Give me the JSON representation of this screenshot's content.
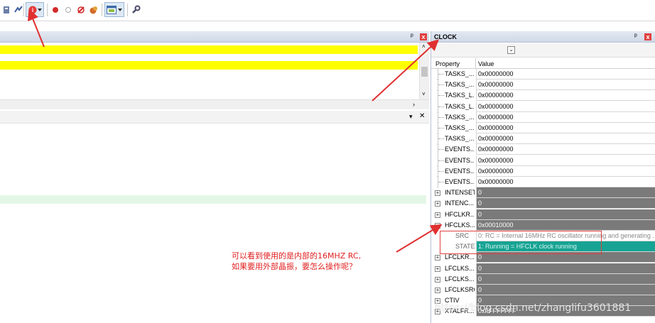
{
  "toolbar": {
    "icons": [
      "step-icon",
      "reset-icon",
      "trace-icon",
      "breakpoint-icon",
      "breakpoint-empty-icon",
      "disable-breakpoint-icon",
      "kill-breakpoints-icon",
      "window-layout-icon",
      "settings-wrench-icon"
    ]
  },
  "clock_pane": {
    "title": "CLOCK",
    "pin_glyph": "ᵖ",
    "close_glyph": "x",
    "columns": {
      "property": "Property",
      "value": "Value"
    },
    "rows": [
      {
        "name": "TASKS_...",
        "value": "0x00000000"
      },
      {
        "name": "TASKS_...",
        "value": "0x00000000"
      },
      {
        "name": "TASKS_L...",
        "value": "0x00000000"
      },
      {
        "name": "TASKS_L...",
        "value": "0x00000000"
      },
      {
        "name": "TASKS_...",
        "value": "0x00000000"
      },
      {
        "name": "TASKS_...",
        "value": "0x00000000"
      },
      {
        "name": "TASKS_...",
        "value": "0x00000000"
      },
      {
        "name": "EVENTS...",
        "value": "0x00000000"
      },
      {
        "name": "EVENTS...",
        "value": "0x00000000"
      },
      {
        "name": "EVENTS...",
        "value": "0x00000000"
      },
      {
        "name": "EVENTS...",
        "value": "0x00000000"
      },
      {
        "name": "INTENSET",
        "value": "0"
      },
      {
        "name": "INTENC...",
        "value": "0"
      },
      {
        "name": "HFCLKR...",
        "value": "0"
      },
      {
        "name": "HFCLKS...",
        "value": "0x00010000"
      },
      {
        "name": "SRC",
        "value": "0: RC = Internal 16MHz RC oscillator running and generating ..."
      },
      {
        "name": "STATE",
        "value": "1: Running = HFCLK clock running"
      },
      {
        "name": "LFCLKR...",
        "value": "0"
      },
      {
        "name": "LFCLKS...",
        "value": "0"
      },
      {
        "name": "LFCLKS...",
        "value": "0"
      },
      {
        "name": "LFCLKSRC",
        "value": "0"
      },
      {
        "name": "CTIV",
        "value": "0"
      },
      {
        "name": "XTALFR...",
        "value": "0xFFFFFFFF"
      }
    ]
  },
  "left_pane": {
    "close_glyph": "✕",
    "pin_glyph": "ᵖ",
    "dropdown_glyph": "▾"
  },
  "annotation": {
    "line1": "可以看到使用的是内部的16MHZ RC,",
    "line2": "如果要用外部晶振，要怎么操作呢？"
  },
  "watermark": "https://blog.csdn.net/zhanglifu3601881",
  "colors": {
    "highlight": "#ffff00",
    "gray_value": "#7a7a7a",
    "teal_value": "#17a393",
    "annotation": "#e02020"
  }
}
